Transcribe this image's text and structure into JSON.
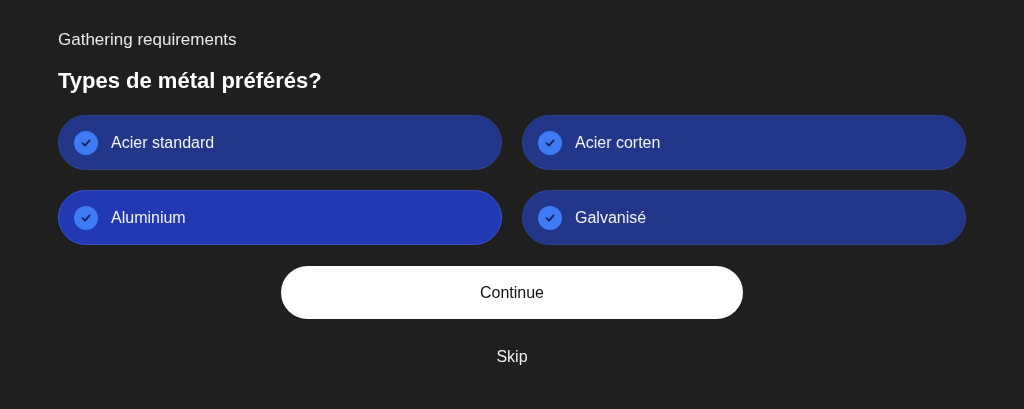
{
  "step_label": "Gathering requirements",
  "question": "Types de métal préférés?",
  "options": [
    {
      "label": "Acier standard",
      "checked": true,
      "focused": false
    },
    {
      "label": "Acier corten",
      "checked": true,
      "focused": false
    },
    {
      "label": "Aluminium",
      "checked": true,
      "focused": true
    },
    {
      "label": "Galvanisé",
      "checked": true,
      "focused": false
    }
  ],
  "continue_button": "Continue",
  "skip_link": "Skip"
}
